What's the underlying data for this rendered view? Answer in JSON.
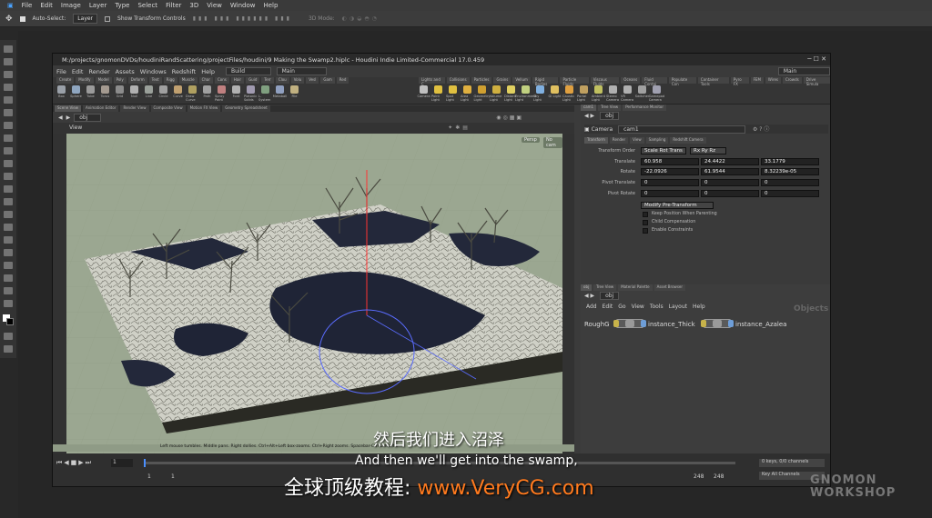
{
  "photoshop": {
    "menu": [
      "File",
      "Edit",
      "Image",
      "Layer",
      "Type",
      "Select",
      "Filter",
      "3D",
      "View",
      "Window",
      "Help"
    ],
    "options": {
      "auto_select": "Auto-Select:",
      "layer_dropdown": "Layer",
      "transform_controls": "Show Transform Controls",
      "mode_3d": "3D Mode:"
    }
  },
  "houdini": {
    "title": "M:/projects/gnomonDVDs/houdiniRandScattering/projectFiles/houdini/9 Making the Swamp2.hiplc - Houdini Indie Limited-Commercial 17.0.459",
    "menu": [
      "File",
      "Edit",
      "Render",
      "Assets",
      "Windows",
      "Redshift",
      "Help"
    ],
    "desktop_dropdown": "Build",
    "main_dropdown": "Main",
    "right_main_dropdown": "Main",
    "shelf_tabs_left": [
      "Create",
      "Modify",
      "Model",
      "Poly",
      "Deform",
      "Text",
      "Rigg",
      "Muscle",
      "Char",
      "Cons",
      "Hair",
      "Guid",
      "Terr",
      "Clou",
      "Volu",
      "Vesl",
      "Gam",
      "Red"
    ],
    "shelf_tabs_right": [
      "Lights and C",
      "Collisions",
      "Particles",
      "Grains",
      "Vellum",
      "Rigid Bodies",
      "Particle Fluids",
      "Viscous Fluids",
      "Oceans",
      "Fluid Contai",
      "Populate Con",
      "Container Tools",
      "Pyro FX",
      "FEM",
      "Wires",
      "Crowds",
      "Drive Simula"
    ],
    "shelf_tools_left": [
      {
        "label": "Box",
        "color": "#9aa0a8"
      },
      {
        "label": "Sphere",
        "color": "#8fa6c0"
      },
      {
        "label": "Tube",
        "color": "#9a9a9a"
      },
      {
        "label": "Torus",
        "color": "#a49a90"
      },
      {
        "label": "Grid",
        "color": "#8c8c8c"
      },
      {
        "label": "Null",
        "color": "#b0b0b0"
      },
      {
        "label": "Line",
        "color": "#9aa09a"
      },
      {
        "label": "Circle",
        "color": "#a0a0a0"
      },
      {
        "label": "Curve",
        "color": "#c0a070"
      },
      {
        "label": "Draw Curve",
        "color": "#b0a060"
      },
      {
        "label": "Path",
        "color": "#a0a0a0"
      },
      {
        "label": "Spray Paint",
        "color": "#c08080"
      },
      {
        "label": "Font",
        "color": "#b0b0b0"
      },
      {
        "label": "Platonic Solids",
        "color": "#a09ab0"
      },
      {
        "label": "L-System",
        "color": "#80a080"
      },
      {
        "label": "Metaball",
        "color": "#90a0c0"
      },
      {
        "label": "File",
        "color": "#c0b080"
      }
    ],
    "shelf_tools_right": [
      {
        "label": "Camera",
        "color": "#c0c0c0"
      },
      {
        "label": "Point Light",
        "color": "#e0c040"
      },
      {
        "label": "Spot Light",
        "color": "#e0c040"
      },
      {
        "label": "Area Light",
        "color": "#e0b040"
      },
      {
        "label": "Geometry Light",
        "color": "#d0a030"
      },
      {
        "label": "Volume Light",
        "color": "#d0b040"
      },
      {
        "label": "Distant Light",
        "color": "#e0d060"
      },
      {
        "label": "Environment Light",
        "color": "#c0d080"
      },
      {
        "label": "Sky Light",
        "color": "#80b0e0"
      },
      {
        "label": "GI Light",
        "color": "#e0c060"
      },
      {
        "label": "Caustic Light",
        "color": "#e0a040"
      },
      {
        "label": "Portal Light",
        "color": "#c0a060"
      },
      {
        "label": "Ambient Light",
        "color": "#c0c060"
      },
      {
        "label": "Stereo Camera",
        "color": "#b0b0b0"
      },
      {
        "label": "VR Camera",
        "color": "#b0b0b0"
      },
      {
        "label": "Switcher",
        "color": "#a0a0a0"
      },
      {
        "label": "Gamepad Camera",
        "color": "#a0a0b0"
      }
    ],
    "pane_tabs_left": [
      "Scene View",
      "Animation Editor",
      "Render View",
      "Composite View",
      "Motion FX View",
      "Geometry Spreadsheet"
    ],
    "path_left": "obj",
    "viewport_label": "View",
    "persp_label": "Persp",
    "cam_label": "No cam",
    "status_hint": "Left mouse tumbles. Middle pans. Right dollies. Ctrl+Alt+Left box-zooms. Ctrl+Right zooms. Spacebar-Ctrl-Left tilts.",
    "params": {
      "tabs_top": [
        "cam1",
        "Tree View",
        "Performance Monitor"
      ],
      "path": "obj",
      "node_type": "Camera",
      "node_name": "cam1",
      "param_tabs": [
        "Transform",
        "Render",
        "View",
        "Sampling",
        "Redshift Camera"
      ],
      "transform_order_label": "Transform Order",
      "transform_order_value": "Scale Rot Trans",
      "rotate_order_value": "Rx Ry Rz",
      "translate_label": "Translate",
      "translate": [
        "60.958",
        "24.4422",
        "33.1779"
      ],
      "rotate_label": "Rotate",
      "rotate": [
        "-22.0926",
        "61.9544",
        "8.32239e-05"
      ],
      "pivot_translate_label": "Pivot Translate",
      "pivot_translate": [
        "0",
        "0",
        "0"
      ],
      "pivot_rotate_label": "Pivot Rotate",
      "pivot_rotate": [
        "0",
        "0",
        "0"
      ],
      "modify_pretransform": "Modify Pre-Transform",
      "checks": [
        "Keep Position When Parenting",
        "Child Compensation",
        "Enable Constraints"
      ]
    },
    "network": {
      "tabs_top": [
        "obj",
        "Tree View",
        "Material Palette",
        "Asset Browser"
      ],
      "path": "obj",
      "menu": [
        "Add",
        "Edit",
        "Go",
        "View",
        "Tools",
        "Layout",
        "Help"
      ],
      "context_label": "Objects",
      "nodes": [
        "RoughG",
        "instance_Thick",
        "instance_Azalea"
      ]
    },
    "timeline": {
      "frame": "1",
      "start": "1",
      "range_start": "1",
      "end": "248",
      "end2": "248",
      "keys_info": "0 keys, 0/0 channels",
      "key_all": "Key All Channels"
    }
  },
  "subtitles": {
    "chinese": "然后我们进入沼泽",
    "english": "And then we'll get into the swamp,",
    "brand_prefix": "全球顶级教程: ",
    "brand_url": "www.VeryCG.com"
  },
  "watermark": {
    "line1": "gnomon",
    "line2": "WORKSHOP"
  }
}
